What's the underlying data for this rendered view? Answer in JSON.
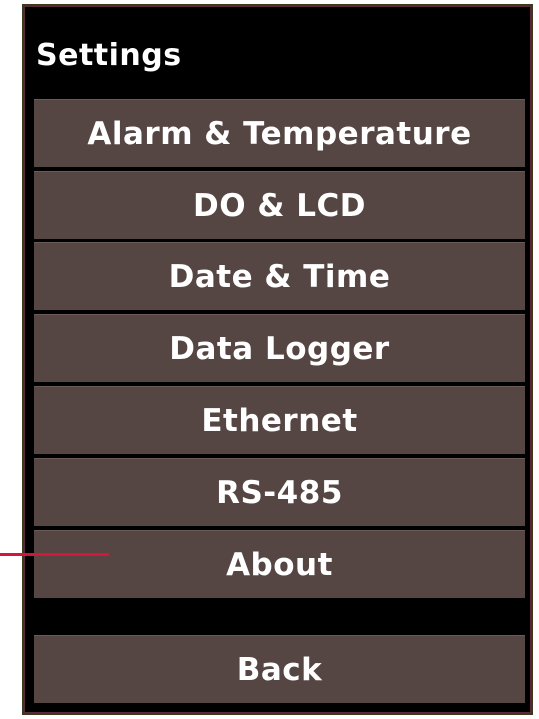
{
  "header": {
    "title": "Settings"
  },
  "menu": {
    "items": [
      {
        "label": "Alarm & Temperature"
      },
      {
        "label": "DO & LCD"
      },
      {
        "label": "Date & Time"
      },
      {
        "label": "Data Logger"
      },
      {
        "label": "Ethernet"
      },
      {
        "label": "RS-485"
      },
      {
        "label": "About"
      }
    ],
    "back_label": "Back"
  },
  "colors": {
    "background": "#000000",
    "button": "#554543",
    "text": "#ffffff",
    "pointer_line": "#d4163a"
  }
}
